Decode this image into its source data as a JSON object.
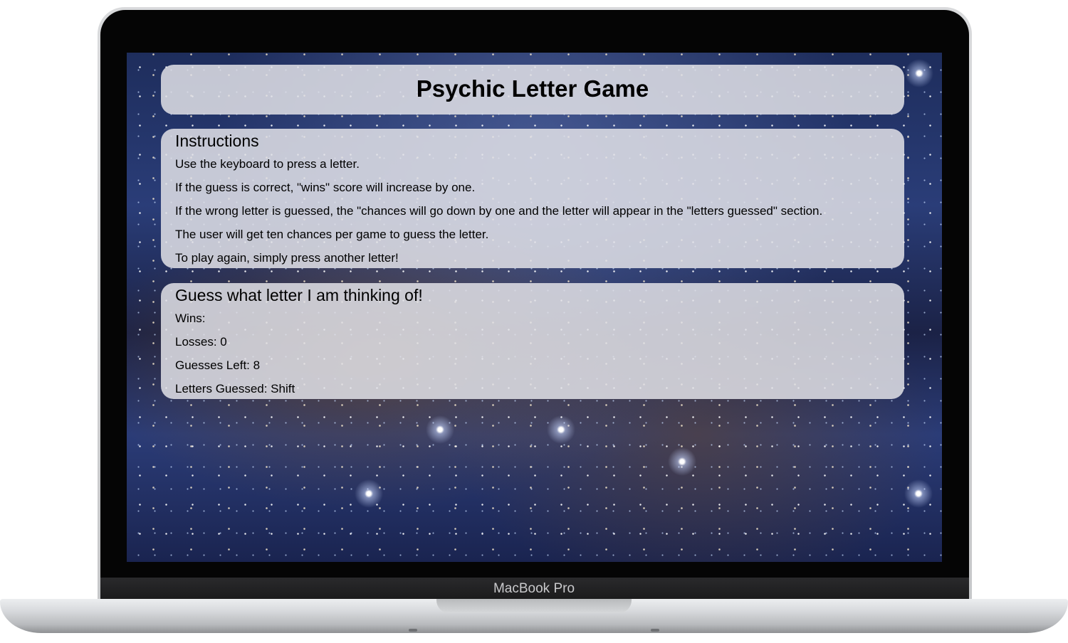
{
  "device": {
    "brand_label": "MacBook Pro"
  },
  "header": {
    "title": "Psychic Letter Game"
  },
  "instructions": {
    "heading": "Instructions",
    "lines": [
      "Use the keyboard to press a letter.",
      "If the guess is correct, \"wins\" score will increase by one.",
      "If the wrong letter is guessed, the \"chances will go down by one and the letter will appear in the \"letters guessed\" section.",
      "The user will get ten chances per game to guess the letter.",
      "To play again, simply press another letter!"
    ]
  },
  "game": {
    "heading": "Guess what letter I am thinking of!",
    "wins": "Wins:",
    "losses": "Losses: 0",
    "guesses_left": "Guesses Left: 8",
    "letters_guessed": "Letters Guessed: Shift"
  },
  "colors": {
    "panel_background": "#e1e1e6",
    "text": "#000000",
    "space_background": "#2a3d78"
  }
}
